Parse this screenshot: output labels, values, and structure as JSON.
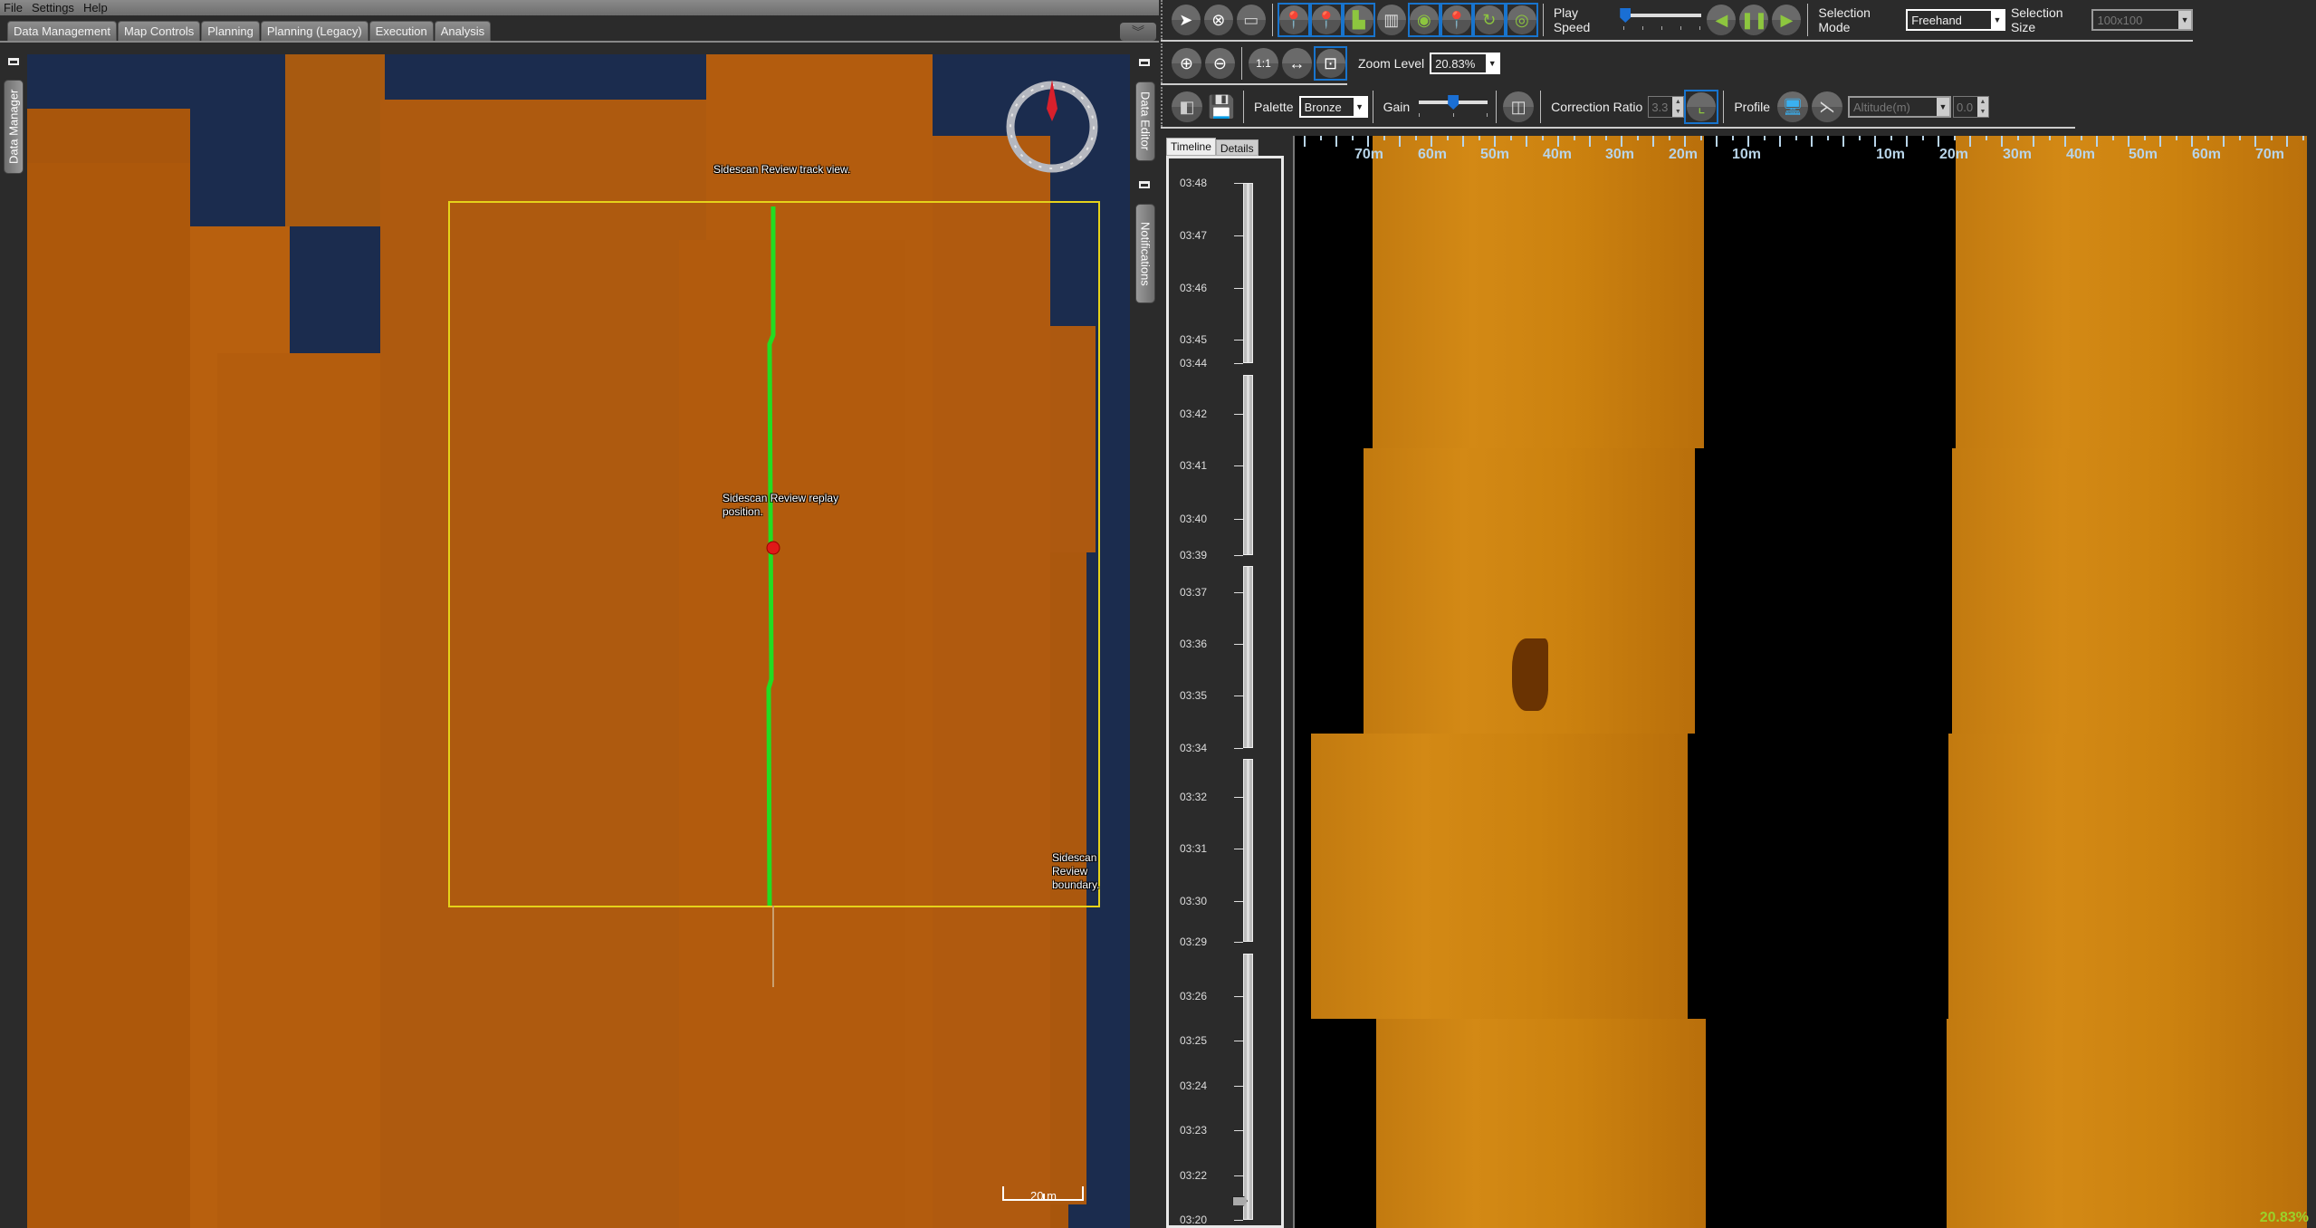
{
  "menu": [
    "File",
    "Settings",
    "Help"
  ],
  "tabs": [
    "Data Management",
    "Map Controls",
    "Planning",
    "Planning (Legacy)",
    "Execution",
    "Analysis"
  ],
  "left_dock": {
    "data_manager": "Data Manager"
  },
  "right_dock": {
    "data_editor": "Data Editor",
    "notifications": "Notifications"
  },
  "map": {
    "track_label": "Sidescan Review track view.",
    "replay_label": "Sidescan Review replay position.",
    "boundary_label": "Sidescan Review boundary.",
    "scale_label": "20 m",
    "colors": {
      "water": "#1b2c4e",
      "mosaic": "#b05a0c",
      "track": "#22dd22",
      "boundary": "#e6d21a",
      "marker": "#e01818"
    }
  },
  "toolbar1": {
    "icons": [
      "pointer-icon",
      "select-area-icon",
      "ruler-icon",
      "add-marker-icon",
      "delete-marker-icon",
      "layer-icon",
      "profile-view-icon",
      "eye-marker-icon",
      "marker-list-icon",
      "route-marker-icon",
      "target-map-icon"
    ],
    "play_speed_label": "Play Speed",
    "play_speed_value": 0,
    "selection_mode_label": "Selection Mode",
    "selection_mode_value": "Freehand",
    "selection_size_label": "Selection Size",
    "selection_size_value": "100x100"
  },
  "toolbar2": {
    "zoom_level_label": "Zoom Level",
    "zoom_level_value": "20.83%"
  },
  "toolbar3": {
    "palette_label": "Palette",
    "palette_value": "Bronze",
    "gain_label": "Gain",
    "gain_value": 0.5,
    "correction_ratio_label": "Correction Ratio",
    "correction_ratio_value": "3.3",
    "profile_label": "Profile",
    "profile_value": "Altitude(m)",
    "profile_number": "0.0"
  },
  "timeline": {
    "tabs": [
      "Timeline",
      "Details"
    ],
    "labels": [
      "03:48",
      "03:47",
      "03:46",
      "03:45",
      "03:44",
      "03:42",
      "03:41",
      "03:40",
      "03:39",
      "03:37",
      "03:36",
      "03:35",
      "03:34",
      "03:32",
      "03:31",
      "03:30",
      "03:29",
      "03:26",
      "03:25",
      "03:24",
      "03:23",
      "03:22",
      "03:20"
    ],
    "current": "03:24"
  },
  "sonar": {
    "port_ruler": [
      "70m",
      "60m",
      "50m",
      "40m",
      "30m",
      "20m",
      "10m"
    ],
    "stbd_ruler": [
      "10m",
      "20m",
      "30m",
      "40m",
      "50m",
      "60m",
      "70m"
    ],
    "zoom_readout": "20.83%"
  }
}
